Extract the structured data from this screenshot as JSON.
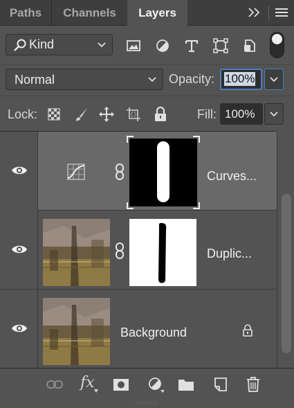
{
  "tabs": [
    {
      "label": "Paths",
      "active": false
    },
    {
      "label": "Channels",
      "active": false
    },
    {
      "label": "Layers",
      "active": true
    }
  ],
  "filter": {
    "kind_label": "Kind",
    "icons": [
      "pixel-filter-icon",
      "adjustment-filter-icon",
      "type-filter-icon",
      "shape-filter-icon",
      "smart-object-filter-icon"
    ]
  },
  "blend": {
    "mode": "Normal",
    "opacity_label": "Opacity:",
    "opacity_value": "100%"
  },
  "lock": {
    "label": "Lock:",
    "fill_label": "Fill:",
    "fill_value": "100%"
  },
  "layers": [
    {
      "name": "Curves...",
      "type": "adjustment",
      "selected": true,
      "visible": true,
      "has_mask": true
    },
    {
      "name": "Duplic...",
      "type": "pixel",
      "selected": false,
      "visible": true,
      "has_mask": true
    },
    {
      "name": "Background",
      "type": "pixel",
      "selected": false,
      "visible": true,
      "locked": true
    }
  ],
  "bottom_toolbar": {
    "fx_label": "fx"
  },
  "colors": {
    "panel_bg": "#535353",
    "selected_row": "#696969",
    "tab_bar": "#3e3e3e",
    "accent": "#4a7fc1"
  }
}
